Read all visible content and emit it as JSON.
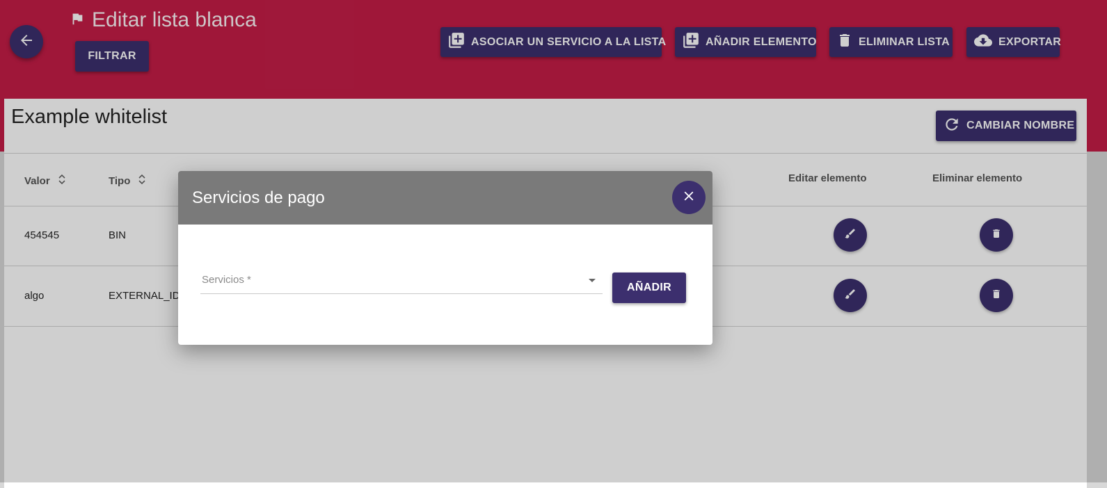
{
  "header": {
    "title": "Editar lista blanca",
    "filter_label": "FILTRAR",
    "actions": {
      "associate_service": "ASOCIAR UN SERVICIO A LA LISTA",
      "add_element": "AÑADIR ELEMENTO",
      "delete_list": "ELIMINAR LISTA",
      "export": "EXPORTAR"
    }
  },
  "card": {
    "title": "Example whitelist",
    "rename_label": "CAMBIAR NOMBRE"
  },
  "table": {
    "columns": {
      "value": "Valor",
      "type": "Tipo",
      "edit": "Editar elemento",
      "delete": "Eliminar elemento"
    },
    "rows": [
      {
        "value": "454545",
        "type": "BIN"
      },
      {
        "value": "algo",
        "type": "EXTERNAL_ID"
      }
    ]
  },
  "dialog": {
    "title": "Servicios de pago",
    "select_placeholder": "Servicios *",
    "add_label": "AÑADIR"
  },
  "colors": {
    "header_bg": "#c41d47",
    "accent": "#3c2f6e",
    "dialog_header": "#7a7a7a"
  }
}
